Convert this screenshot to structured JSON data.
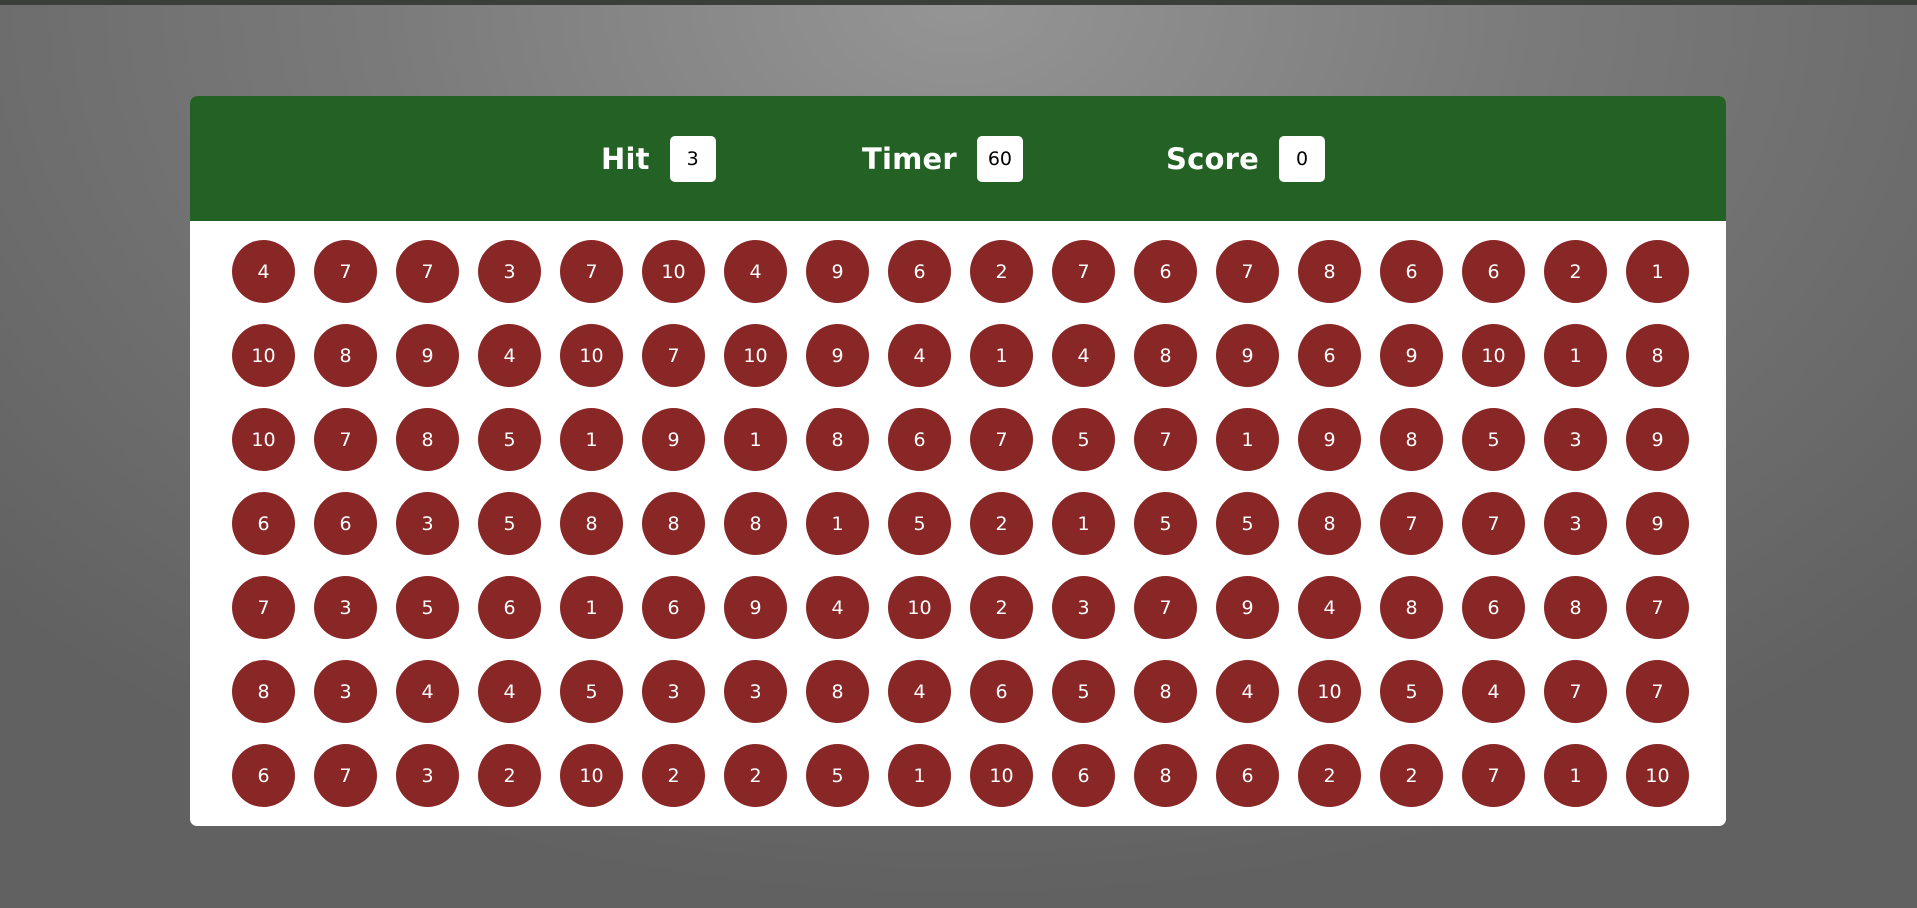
{
  "panel": {
    "hit": {
      "label": "Hit",
      "value": "3"
    },
    "timer": {
      "label": "Timer",
      "value": "60"
    },
    "score": {
      "label": "Score",
      "value": "0"
    }
  },
  "colors": {
    "header_bg": "#236124",
    "bubble_bg": "#892727",
    "panel_bg": "#ffffff"
  },
  "bubbles": [
    [
      "4",
      "7",
      "7",
      "3",
      "7",
      "10",
      "4",
      "9",
      "6",
      "2",
      "7",
      "6",
      "7",
      "8",
      "6",
      "6",
      "2",
      "1"
    ],
    [
      "10",
      "8",
      "9",
      "4",
      "10",
      "7",
      "10",
      "9",
      "4",
      "1",
      "4",
      "8",
      "9",
      "6",
      "9",
      "10",
      "1",
      "8"
    ],
    [
      "10",
      "7",
      "8",
      "5",
      "1",
      "9",
      "1",
      "8",
      "6",
      "7",
      "5",
      "7",
      "1",
      "9",
      "8",
      "5",
      "3",
      "9"
    ],
    [
      "6",
      "6",
      "3",
      "5",
      "8",
      "8",
      "8",
      "1",
      "5",
      "2",
      "1",
      "5",
      "5",
      "8",
      "7",
      "7",
      "3",
      "9"
    ],
    [
      "7",
      "3",
      "5",
      "6",
      "1",
      "6",
      "9",
      "4",
      "10",
      "2",
      "3",
      "7",
      "9",
      "4",
      "8",
      "6",
      "8",
      "7"
    ],
    [
      "8",
      "3",
      "4",
      "4",
      "5",
      "3",
      "3",
      "8",
      "4",
      "6",
      "5",
      "8",
      "4",
      "10",
      "5",
      "4",
      "7",
      "7"
    ],
    [
      "6",
      "7",
      "3",
      "2",
      "10",
      "2",
      "2",
      "5",
      "1",
      "10",
      "6",
      "8",
      "6",
      "2",
      "2",
      "7",
      "1",
      "10"
    ]
  ]
}
